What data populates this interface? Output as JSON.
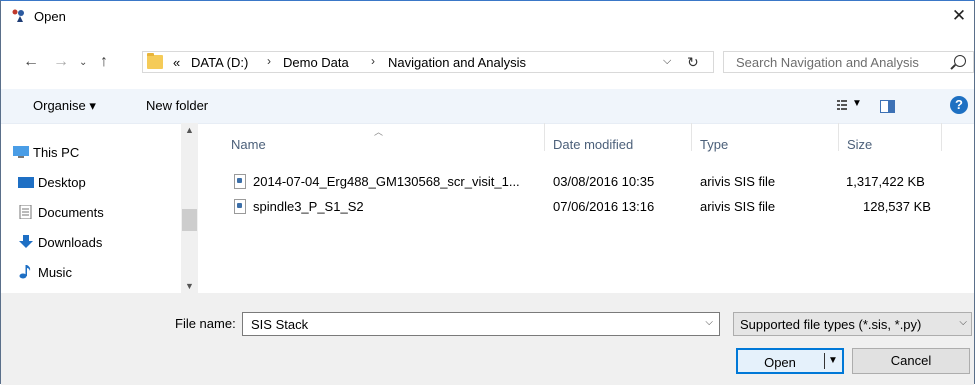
{
  "window": {
    "title": "Open",
    "close": "✕"
  },
  "address": {
    "crumbs": [
      "«",
      "DATA (D:)",
      "Demo Data",
      "Navigation and Analysis"
    ],
    "separator": "›",
    "search_placeholder": "Search Navigation and Analysis"
  },
  "toolbar": {
    "organise": "Organise ▾",
    "new_folder": "New folder",
    "help": "?"
  },
  "nav": {
    "items": [
      {
        "label": "This PC",
        "icon": "pc-icon"
      },
      {
        "label": "Desktop",
        "icon": "desktop-icon"
      },
      {
        "label": "Documents",
        "icon": "documents-icon"
      },
      {
        "label": "Downloads",
        "icon": "downloads-icon"
      },
      {
        "label": "Music",
        "icon": "music-icon"
      }
    ]
  },
  "columns": {
    "name": "Name",
    "date": "Date modified",
    "type": "Type",
    "size": "Size"
  },
  "files": [
    {
      "name": "2014-07-04_Erg488_GM130568_scr_visit_1...",
      "date": "03/08/2016 10:35",
      "type": "arivis SIS file",
      "size": "1,317,422 KB"
    },
    {
      "name": "spindle3_P_S1_S2",
      "date": "07/06/2016 13:16",
      "type": "arivis SIS file",
      "size": "128,537 KB"
    }
  ],
  "bottom": {
    "file_name_label": "File name:",
    "file_name_value": "SIS Stack",
    "file_type": "Supported file types (*.sis, *.py)",
    "open": "Open",
    "cancel": "Cancel"
  },
  "colors": {
    "accent": "#0078d7",
    "toolbar_bg": "#f0f5fb",
    "panel_bg": "#f0f0f0"
  }
}
